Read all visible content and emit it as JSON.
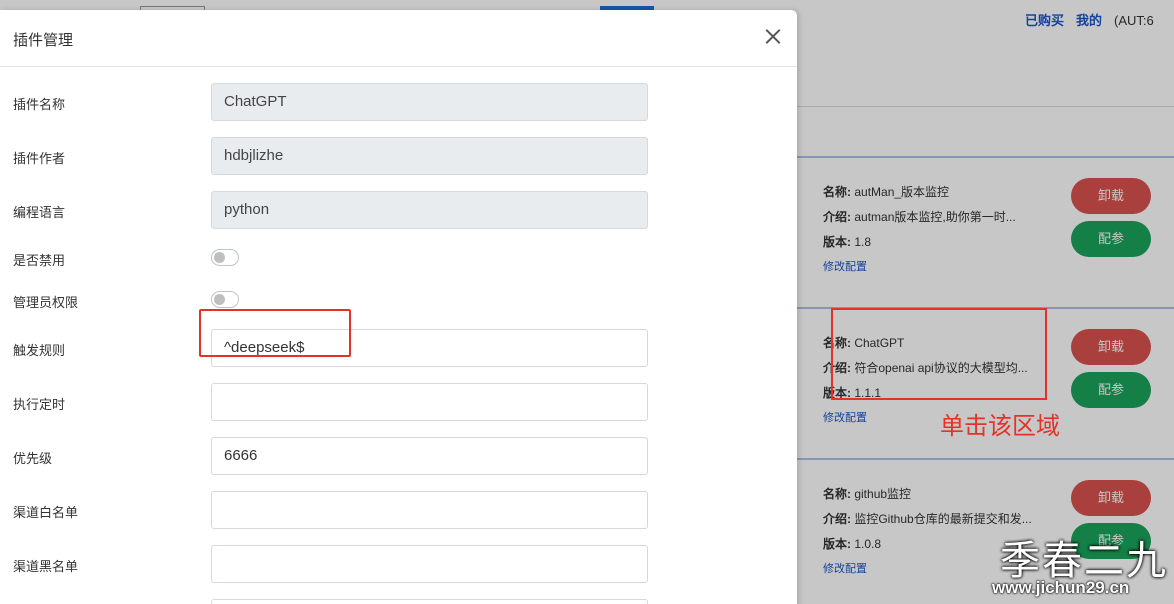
{
  "background": {
    "nav": {
      "purchased": "已购买",
      "mine": "我的",
      "aut": "(AUT:6"
    },
    "cards": [
      {
        "name_label": "名称:",
        "name": "autMan_版本监控",
        "intro_label": "介绍:",
        "intro": "autman版本监控,助你第一时...",
        "version_label": "版本:",
        "version": "1.8",
        "config_link": "修改配置",
        "uninstall": "卸载",
        "configure": "配参"
      },
      {
        "name_label": "名称:",
        "name": "ChatGPT",
        "intro_label": "介绍:",
        "intro": "符合openai api协议的大模型均...",
        "version_label": "版本:",
        "version": "1.1.1",
        "config_link": "修改配置",
        "uninstall": "卸载",
        "configure": "配参"
      },
      {
        "name_label": "名称:",
        "name": "github监控",
        "intro_label": "介绍:",
        "intro": "监控Github仓库的最新提交和发...",
        "version_label": "版本:",
        "version": "1.0.8",
        "config_link": "修改配置",
        "uninstall": "卸载",
        "configure": "配参"
      }
    ]
  },
  "annotation": {
    "text": "单击该区域",
    "color": "#e53228"
  },
  "watermark": {
    "brand": "季春二九",
    "url": "www.jichun29.cn"
  },
  "modal": {
    "title": "插件管理",
    "fields": {
      "name": {
        "label": "插件名称",
        "value": "ChatGPT"
      },
      "author": {
        "label": "插件作者",
        "value": "hdbjlizhe"
      },
      "language": {
        "label": "编程语言",
        "value": "python"
      },
      "disabled": {
        "label": "是否禁用",
        "on": false
      },
      "admin": {
        "label": "管理员权限",
        "on": false
      },
      "trigger": {
        "label": "触发规则",
        "value": "^deepseek$"
      },
      "cron": {
        "label": "执行定时",
        "value": ""
      },
      "priority": {
        "label": "优先级",
        "value": "6666"
      },
      "whitelist": {
        "label": "渠道白名单",
        "value": ""
      },
      "blacklist": {
        "label": "渠道黑名单",
        "value": ""
      }
    }
  },
  "colors": {
    "uninstall_btn": "#d9534f",
    "configure_btn": "#1aa35a",
    "link": "#1a56c8"
  }
}
